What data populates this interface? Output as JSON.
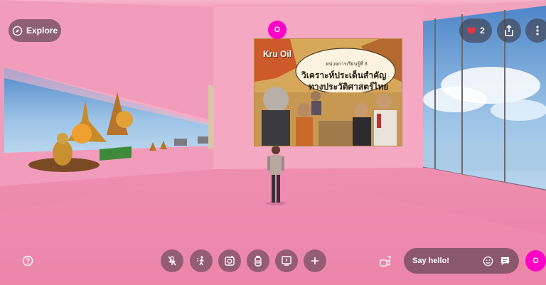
{
  "top_left": {
    "explore_label": "Explore"
  },
  "host_avatar": {
    "initial": "O"
  },
  "top_right": {
    "likes_count": "2"
  },
  "poster": {
    "brand": "Kru Oil",
    "unit_label": "หน่วยการเรียนรู้ที่ 3",
    "title_line1": "วิเคราะห์ประเด็นสำคัญ",
    "title_line2": "ทางประวัติศาสตร์ไทย"
  },
  "chat": {
    "placeholder": "Say hello!"
  },
  "user_avatar": {
    "initial": "O"
  },
  "colors": {
    "accent": "#ff00c8",
    "heart": "#e8323c",
    "room_pink": "#f08fb2"
  },
  "icons": [
    "compass-icon",
    "heart-icon",
    "share-icon",
    "more-vertical-icon",
    "help-icon",
    "mic-off-icon",
    "emote-icon",
    "camera-icon",
    "backpack-icon",
    "screen-share-icon",
    "plus-icon",
    "camera-switch-icon",
    "emoji-icon",
    "chat-icon"
  ]
}
